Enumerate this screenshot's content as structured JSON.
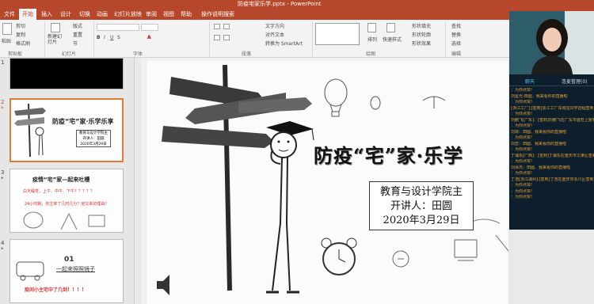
{
  "titlebar": {
    "title": "防疫宅家乐学.pptx - PowerPoint"
  },
  "tabs": [
    "文件",
    "开始",
    "插入",
    "设计",
    "切换",
    "动画",
    "幻灯片放映",
    "审阅",
    "视图",
    "帮助",
    "操作说明搜索"
  ],
  "ribbon": {
    "paste": "粘贴",
    "cut": "剪切",
    "copy": "复制",
    "format_painter": "格式刷",
    "new_slide": "新建幻灯片",
    "layout": "版式",
    "reset": "重置",
    "section": "节",
    "text_direction": "文字方向",
    "align_text": "对齐文本",
    "smartart": "转换为 SmartArt",
    "arrange": "排列",
    "quick_styles": "快速样式",
    "shape_fill": "形状填充",
    "shape_outline": "形状轮廓",
    "shape_effects": "形状效果",
    "find": "查找",
    "replace": "替换",
    "select": "选择",
    "groups": {
      "clipboard": "剪贴板",
      "slides": "幻灯片",
      "font": "字体",
      "paragraph": "段落",
      "drawing": "绘图",
      "editing": "编辑"
    }
  },
  "thumbnails": [
    {
      "num": "1",
      "star": ""
    },
    {
      "num": "2",
      "star": "*",
      "title": "防疫“宅”家·乐学乐享",
      "sub1": "教育与设计学院主",
      "sub2": "开讲人：田圆",
      "sub3": "2020年3月29日"
    },
    {
      "num": "3",
      "star": "*",
      "title": "疫情“宅”家—起来吐槽",
      "line1": "白天睡觉，上午、中午、下午？？？？？",
      "line2": "24小时制，你主宰了几时几分？疫又来的理由？"
    },
    {
      "num": "4",
      "star": "*",
      "n": "01",
      "sub": "一起来照照镜子",
      "foot": "疫间小主宅中了几剑！！！！"
    }
  ],
  "slide": {
    "title": "防疫“宅”家·乐学",
    "info": [
      "教育与设计学院主",
      "开讲人：田圆",
      "2020年3月29日"
    ]
  },
  "chat": {
    "tabs": [
      "聊天",
      "连麦管理(0)"
    ],
    "lines": [
      {
        "t": "：为你点赞!",
        "w": false
      },
      {
        "t": "刘星光:田圆、我来看你的直播啦",
        "w": false
      },
      {
        "t": "：为你点赞!",
        "w": false
      },
      {
        "t": "[浙江工厂]:[签到]浙江工厂东城宝同学远程签到",
        "w": false
      },
      {
        "t": "：为你点赞!",
        "w": false
      },
      {
        "t": "刘鹏飞[广东]：[签到]刘鹏飞在广东市首旺上家要求签到",
        "w": false
      },
      {
        "t": "：为你点赞!",
        "w": false
      },
      {
        "t": "刘琼：田圆、我来看你的直播啦",
        "w": false
      },
      {
        "t": "：为你点赞!",
        "w": false
      },
      {
        "t": "刘恋：田圆、我来看你的直播啦",
        "w": false
      },
      {
        "t": "：为你点赞!",
        "w": false
      },
      {
        "t": "丁浦东[广西]：[签到]丁浦东在重庆市江津区签到",
        "w": false
      },
      {
        "t": "：为你点赞!",
        "w": false
      },
      {
        "t": "刘泽杰：田圆、我来看你的直播啦",
        "w": false
      },
      {
        "t": "：为你点赞!",
        "w": false
      },
      {
        "t": "丁浩[浙江湖州]:[签到]丁浩在重庆市永川区签到",
        "w": false
      },
      {
        "t": "：为你点赞!",
        "w": false
      },
      {
        "t": "：为你点赞!",
        "w": false
      },
      {
        "t": "：为你点赞!",
        "w": false
      }
    ]
  }
}
